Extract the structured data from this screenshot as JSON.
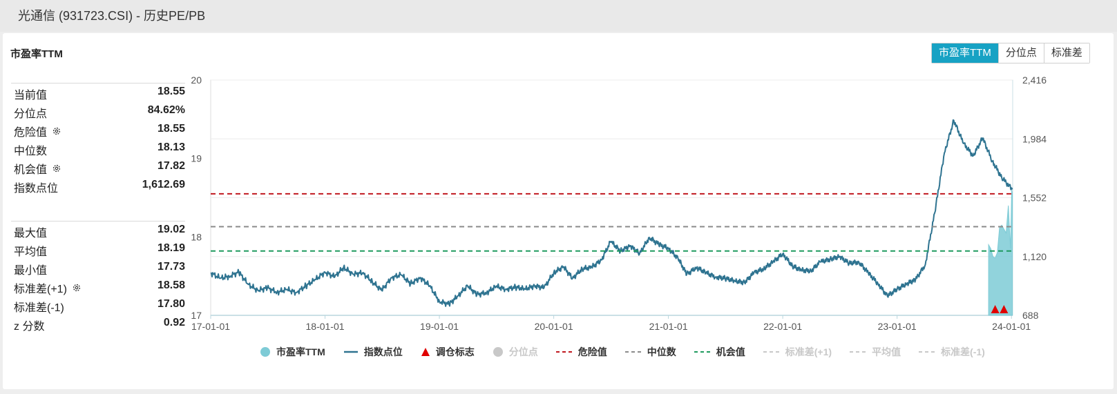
{
  "page": {
    "title": "光通信 (931723.CSI) - 历史PE/PB"
  },
  "panel": {
    "title": "市盈率TTM"
  },
  "tabs": [
    {
      "label": "市盈率TTM",
      "active": true
    },
    {
      "label": "分位点",
      "active": false
    },
    {
      "label": "标准差",
      "active": false
    }
  ],
  "stats": {
    "group1": [
      {
        "label": "当前值",
        "value": "18.55",
        "gear": false
      },
      {
        "label": "分位点",
        "value": "84.62%",
        "gear": false
      },
      {
        "label": "危险值",
        "value": "18.55",
        "gear": true
      },
      {
        "label": "中位数",
        "value": "18.13",
        "gear": false
      },
      {
        "label": "机会值",
        "value": "17.82",
        "gear": true
      },
      {
        "label": "指数点位",
        "value": "1,612.69",
        "gear": false
      }
    ],
    "group2": [
      {
        "label": "最大值",
        "value": "19.02",
        "gear": false
      },
      {
        "label": "平均值",
        "value": "18.19",
        "gear": false
      },
      {
        "label": "最小值",
        "value": "17.73",
        "gear": false
      },
      {
        "label": "标准差(+1)",
        "value": "18.58",
        "gear": true
      },
      {
        "label": "标准差(-1)",
        "value": "17.80",
        "gear": false
      },
      {
        "label": "z 分数",
        "value": "0.92",
        "gear": false
      }
    ]
  },
  "legend": [
    {
      "label": "市盈率TTM",
      "symbol": "circle",
      "color": "#7ecbd6",
      "enabled": true
    },
    {
      "label": "指数点位",
      "symbol": "line",
      "color": "#2e7390",
      "enabled": true
    },
    {
      "label": "调仓标志",
      "symbol": "triangle",
      "color": "#e00000",
      "enabled": true
    },
    {
      "label": "分位点",
      "symbol": "circle",
      "color": "#c8c8c8",
      "enabled": false
    },
    {
      "label": "危险值",
      "symbol": "dash",
      "color": "#c0171e",
      "enabled": true
    },
    {
      "label": "中位数",
      "symbol": "dash",
      "color": "#8a8a8a",
      "enabled": true
    },
    {
      "label": "机会值",
      "symbol": "dash",
      "color": "#1e9a5e",
      "enabled": true
    },
    {
      "label": "标准差(+1)",
      "symbol": "dash",
      "color": "#c8c8c8",
      "enabled": false
    },
    {
      "label": "平均值",
      "symbol": "dash",
      "color": "#c8c8c8",
      "enabled": false
    },
    {
      "label": "标准差(-1)",
      "symbol": "dash",
      "color": "#c8c8c8",
      "enabled": false
    }
  ],
  "chart_data": {
    "type": "line",
    "x_tick_labels": [
      "17-01-01",
      "18-01-01",
      "19-01-01",
      "20-01-01",
      "21-01-01",
      "22-01-01",
      "23-01-01",
      "24-01-01"
    ],
    "x_ticks": [
      "2017-01-01",
      "2018-01-01",
      "2019-01-01",
      "2020-01-01",
      "2021-01-01",
      "2022-01-01",
      "2023-01-01",
      "2024-01-01"
    ],
    "xlim": [
      "2017-01-01",
      "2024-01-05"
    ],
    "y_left": {
      "ticks": [
        17,
        18,
        19,
        20
      ],
      "lim": [
        17,
        20
      ]
    },
    "y_right": {
      "ticks": [
        688,
        1120,
        1552,
        1984,
        2416
      ],
      "tick_labels": [
        "688",
        "1,120",
        "1,552",
        "1,984",
        "2,416"
      ],
      "lim": [
        688,
        2416
      ]
    },
    "reference_lines": [
      {
        "name": "危险值",
        "value": 18.55,
        "axis": "left",
        "color": "#c0171e"
      },
      {
        "name": "中位数",
        "value": 18.13,
        "axis": "left",
        "color": "#8a8a8a"
      },
      {
        "name": "机会值",
        "value": 17.82,
        "axis": "left",
        "color": "#1e9a5e"
      }
    ],
    "series": [
      {
        "name": "指数点位",
        "axis": "right",
        "color": "#2e7390",
        "points": [
          [
            "2017-01-01",
            1000
          ],
          [
            "2017-02-01",
            960
          ],
          [
            "2017-03-01",
            975
          ],
          [
            "2017-04-01",
            1005
          ],
          [
            "2017-05-01",
            915
          ],
          [
            "2017-06-01",
            870
          ],
          [
            "2017-07-01",
            890
          ],
          [
            "2017-08-01",
            858
          ],
          [
            "2017-09-01",
            878
          ],
          [
            "2017-10-01",
            855
          ],
          [
            "2017-11-01",
            905
          ],
          [
            "2017-12-01",
            950
          ],
          [
            "2018-01-01",
            1005
          ],
          [
            "2018-02-01",
            970
          ],
          [
            "2018-03-01",
            1040
          ],
          [
            "2018-04-01",
            990
          ],
          [
            "2018-05-01",
            1000
          ],
          [
            "2018-06-01",
            935
          ],
          [
            "2018-07-01",
            870
          ],
          [
            "2018-08-01",
            965
          ],
          [
            "2018-09-01",
            985
          ],
          [
            "2018-10-01",
            920
          ],
          [
            "2018-11-01",
            965
          ],
          [
            "2018-12-01",
            905
          ],
          [
            "2019-01-01",
            790
          ],
          [
            "2019-02-01",
            770
          ],
          [
            "2019-03-01",
            830
          ],
          [
            "2019-04-01",
            905
          ],
          [
            "2019-05-01",
            840
          ],
          [
            "2019-06-01",
            855
          ],
          [
            "2019-07-01",
            900
          ],
          [
            "2019-08-01",
            880
          ],
          [
            "2019-09-01",
            895
          ],
          [
            "2019-10-01",
            880
          ],
          [
            "2019-11-01",
            905
          ],
          [
            "2019-12-01",
            890
          ],
          [
            "2020-01-01",
            1000
          ],
          [
            "2020-02-01",
            1045
          ],
          [
            "2020-03-01",
            960
          ],
          [
            "2020-04-01",
            1030
          ],
          [
            "2020-05-01",
            1040
          ],
          [
            "2020-06-01",
            1095
          ],
          [
            "2020-07-01",
            1230
          ],
          [
            "2020-08-01",
            1160
          ],
          [
            "2020-09-01",
            1200
          ],
          [
            "2020-10-01",
            1140
          ],
          [
            "2020-11-01",
            1260
          ],
          [
            "2020-12-01",
            1210
          ],
          [
            "2021-01-01",
            1180
          ],
          [
            "2021-02-01",
            1105
          ],
          [
            "2021-03-01",
            990
          ],
          [
            "2021-04-01",
            1040
          ],
          [
            "2021-05-01",
            1000
          ],
          [
            "2021-06-01",
            970
          ],
          [
            "2021-07-01",
            960
          ],
          [
            "2021-08-01",
            940
          ],
          [
            "2021-09-01",
            930
          ],
          [
            "2021-10-01",
            1000
          ],
          [
            "2021-11-01",
            1030
          ],
          [
            "2021-12-01",
            1080
          ],
          [
            "2022-01-01",
            1140
          ],
          [
            "2022-02-01",
            1050
          ],
          [
            "2022-03-01",
            1020
          ],
          [
            "2022-04-01",
            1015
          ],
          [
            "2022-05-01",
            1080
          ],
          [
            "2022-06-01",
            1100
          ],
          [
            "2022-07-01",
            1120
          ],
          [
            "2022-08-01",
            1070
          ],
          [
            "2022-09-01",
            1080
          ],
          [
            "2022-10-01",
            1000
          ],
          [
            "2022-11-01",
            920
          ],
          [
            "2022-12-01",
            830
          ],
          [
            "2023-01-01",
            880
          ],
          [
            "2023-02-01",
            920
          ],
          [
            "2023-03-01",
            950
          ],
          [
            "2023-04-01",
            1060
          ],
          [
            "2023-05-01",
            1440
          ],
          [
            "2023-06-01",
            1880
          ],
          [
            "2023-07-01",
            2120
          ],
          [
            "2023-08-01",
            1950
          ],
          [
            "2023-09-01",
            1860
          ],
          [
            "2023-10-01",
            1990
          ],
          [
            "2023-11-01",
            1820
          ],
          [
            "2023-12-01",
            1700
          ],
          [
            "2024-01-04",
            1613
          ]
        ]
      },
      {
        "name": "市盈率TTM",
        "axis": "left",
        "color": "#7ecbd6",
        "type": "area",
        "points": [
          [
            "2023-10-20",
            17.9
          ],
          [
            "2023-10-27",
            17.85
          ],
          [
            "2023-11-03",
            17.75
          ],
          [
            "2023-11-10",
            17.73
          ],
          [
            "2023-11-17",
            17.8
          ],
          [
            "2023-11-24",
            18.12
          ],
          [
            "2023-12-01",
            18.15
          ],
          [
            "2023-12-08",
            18.1
          ],
          [
            "2023-12-15",
            18.05
          ],
          [
            "2023-12-22",
            18.4
          ],
          [
            "2023-12-27",
            18.0
          ],
          [
            "2023-12-29",
            17.85
          ],
          [
            "2024-01-02",
            18.6
          ],
          [
            "2024-01-04",
            18.55
          ]
        ]
      }
    ],
    "markers": [
      {
        "name": "调仓标志",
        "dates": [
          "2023-11-10",
          "2023-12-08"
        ],
        "symbol": "triangle",
        "color": "#e00000"
      }
    ]
  }
}
